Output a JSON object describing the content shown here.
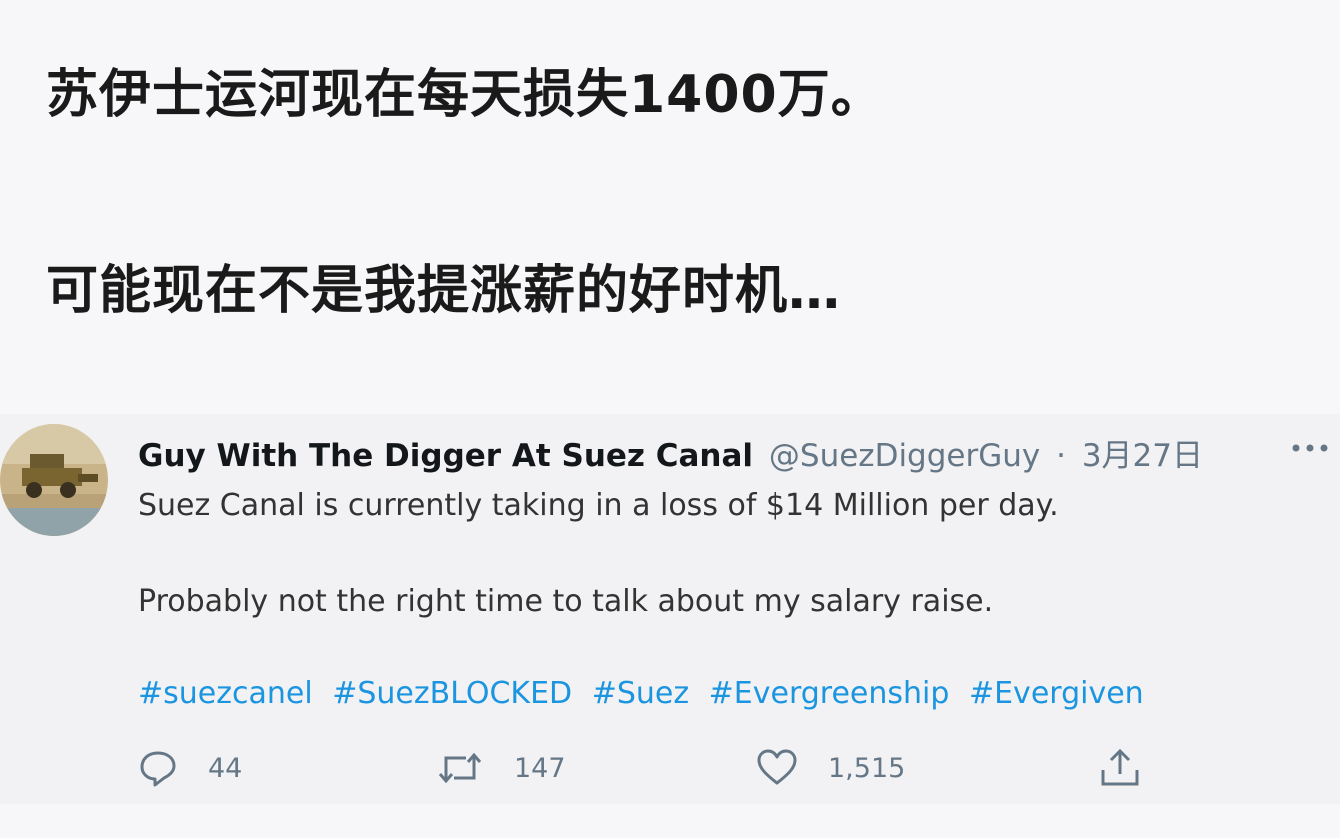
{
  "captions": {
    "line1": "苏伊士运河现在每天损失1400万。",
    "line2": "可能现在不是我提涨薪的好时机…"
  },
  "tweet": {
    "display_name": "Guy With The Digger At Suez Canal",
    "handle": "@SuezDiggerGuy",
    "separator": "·",
    "date": "3月27日",
    "text_line1": "Suez Canal is currently taking in a loss of $14 Million per day.",
    "text_line2": "Probably not the right time to talk about my salary raise.",
    "hashtags": [
      "#suezcanel",
      "#SuezBLOCKED",
      "#Suez",
      "#Evergreenship",
      "#Evergiven"
    ],
    "actions": {
      "reply_count": "44",
      "retweet_count": "147",
      "like_count": "1,515"
    },
    "icons": {
      "reply": "reply-icon",
      "retweet": "retweet-icon",
      "like": "heart-icon",
      "share": "share-icon",
      "more": "more-icon"
    },
    "colors": {
      "hashtag": "#1b95e0",
      "secondary": "#657786"
    }
  }
}
